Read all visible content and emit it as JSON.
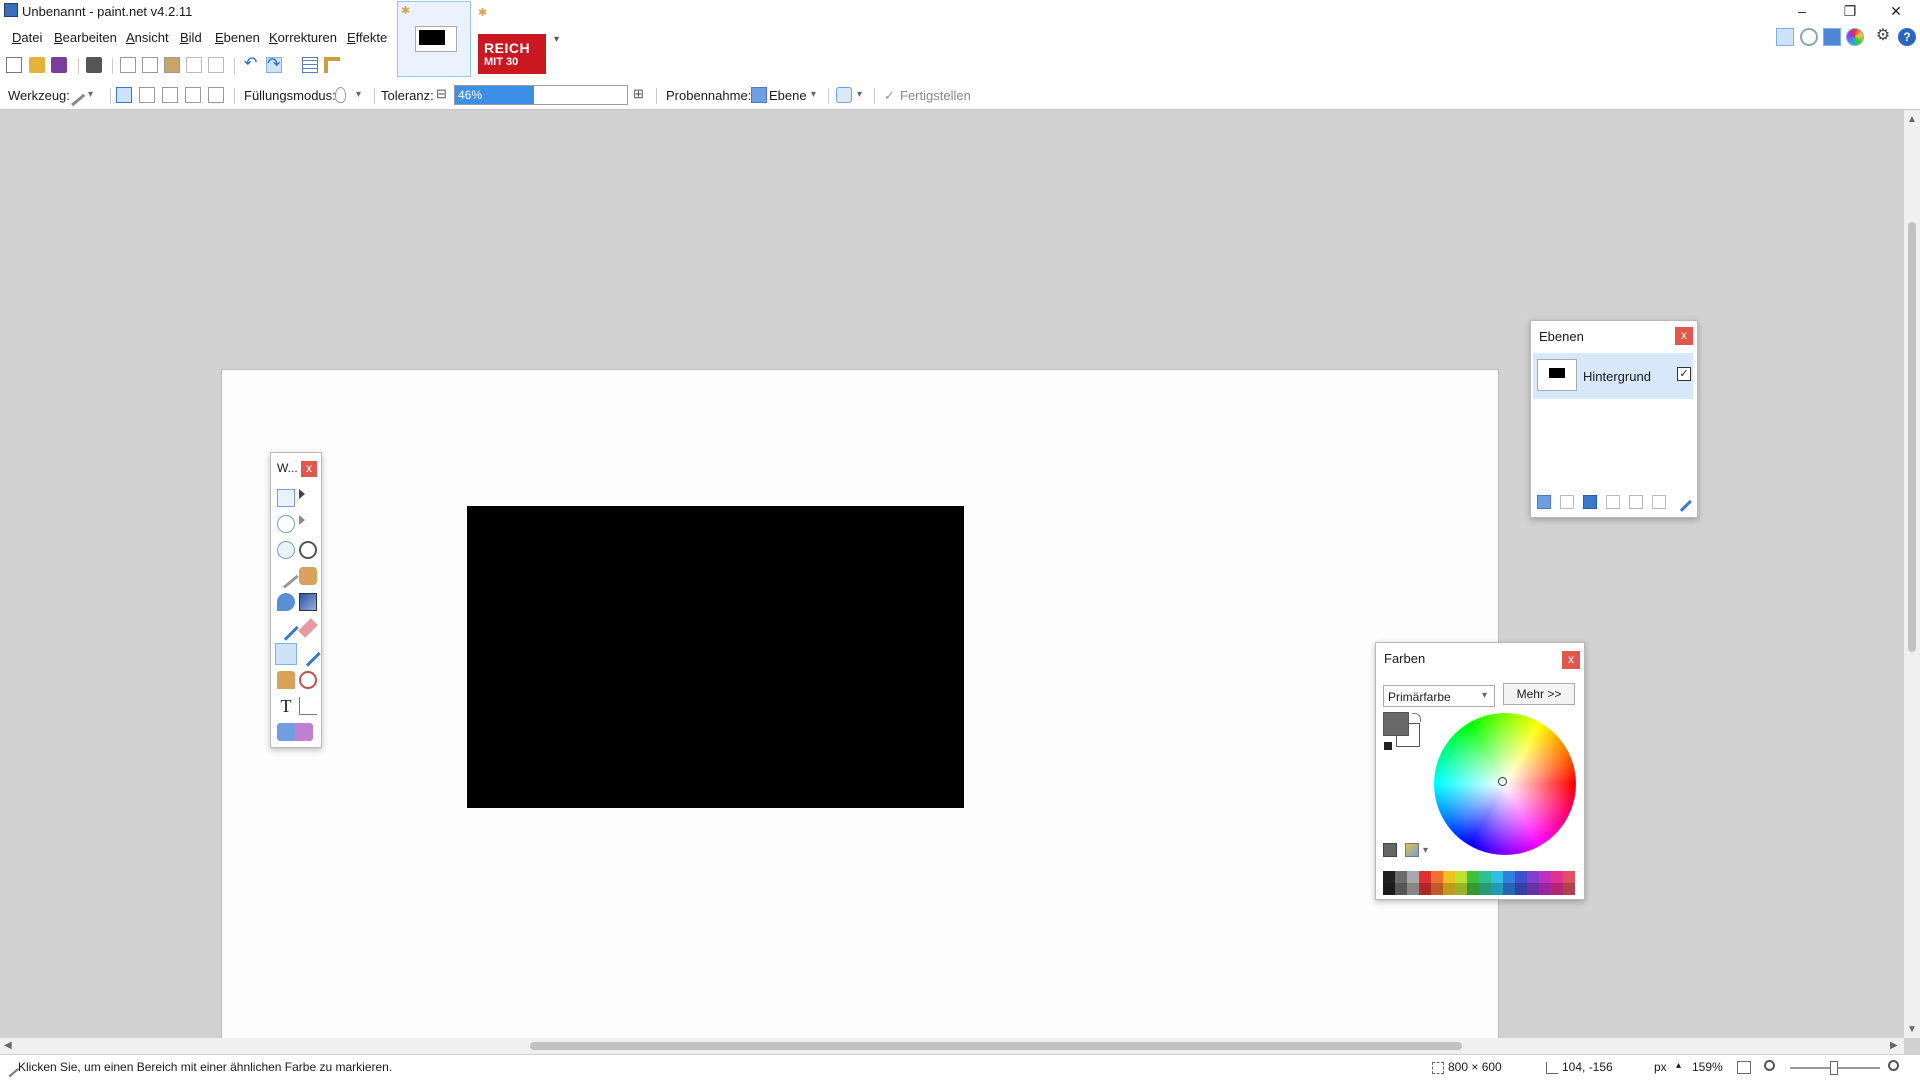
{
  "window": {
    "title": "Unbenannt - paint.net v4.2.11",
    "minimize": "–",
    "maximize": "❐",
    "close": "✕"
  },
  "menu": {
    "items": [
      "Datei",
      "Bearbeiten",
      "Ansicht",
      "Bild",
      "Ebenen",
      "Korrekturen",
      "Effekte"
    ]
  },
  "tabs": {
    "image_tab_text": "REICH",
    "image_tab_sub": "MIT 30",
    "star": "✱",
    "overflow": "▾"
  },
  "tool_options": {
    "tool_label": "Werkzeug:",
    "fill_mode_label": "Füllungsmodus:",
    "tolerance_label": "Toleranz:",
    "tolerance_value": "46%",
    "tolerance_fraction": 0.46,
    "sampling_label": "Probennahme:",
    "sampling_value": "Ebene",
    "finish_label": "Fertigstellen",
    "minus": "⊟",
    "plus": "⊞",
    "dropdown": "▾",
    "check": "✓"
  },
  "tools_window": {
    "title": "W...",
    "close": "x",
    "text_tool_glyph": "T"
  },
  "layers_window": {
    "title": "Ebenen",
    "close": "x",
    "layer_name": "Hintergrund",
    "layer_visible_check": "✓"
  },
  "colors_window": {
    "title": "Farben",
    "close": "x",
    "mode_select": "Primärfarbe",
    "more_button": "Mehr >>",
    "primary_color": "#6a6a6a",
    "secondary_color": "#ffffff"
  },
  "status": {
    "hint": "Klicken Sie, um einen Bereich mit einer ähnlichen Farbe zu markieren.",
    "image_size": "800 × 600",
    "cursor_pos": "104, -156",
    "unit": "px",
    "unit_arrow": "▴",
    "zoom": "159%"
  },
  "scroll": {
    "up": "▲",
    "down": "▼",
    "left": "◀",
    "right": "▶"
  },
  "colors": {
    "accent": "#3b8fe6",
    "panel_close": "#e0574e",
    "canvas_bg": "#d2d2d2"
  },
  "palette": [
    "#202020",
    "#6b6b6b",
    "#a8a8a8",
    "#e03030",
    "#f07030",
    "#f0c020",
    "#c0e030",
    "#40c040",
    "#30c090",
    "#30c0e0",
    "#3080e0",
    "#4050d0",
    "#8040d0",
    "#c030c0",
    "#e03090",
    "#e05060"
  ]
}
